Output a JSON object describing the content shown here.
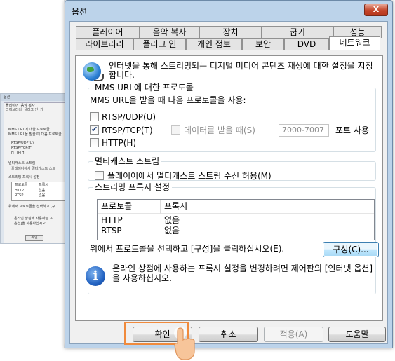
{
  "window": {
    "title": "옵션",
    "close_label": "X"
  },
  "tabs_top": [
    {
      "label": "플레이어"
    },
    {
      "label": "음악 복사"
    },
    {
      "label": "장치"
    },
    {
      "label": "굽기"
    },
    {
      "label": "성능"
    }
  ],
  "tabs_bottom": [
    {
      "label": "라이브러리"
    },
    {
      "label": "플러그 인"
    },
    {
      "label": "개인 정보"
    },
    {
      "label": "보안"
    },
    {
      "label": "DVD"
    },
    {
      "label": "네트워크"
    }
  ],
  "intro_text": "인터넷을 통해 스트리밍되는 디지털 미디어 콘텐츠 재생에 대한 설정을 지정합니다.",
  "mms": {
    "group_title": "MMS URL에 대한 프로토콜",
    "caption": "MMS URL을 받을 때 다음 프로토콜을 사용:",
    "rtsp_udp": "RTSP/UDP(U)",
    "rtsp_tcp": "RTSP/TCP(T)",
    "http": "HTTP(H)",
    "data_ports_label": "데이터를 받을 때(S)",
    "ports_value": "7000-7007",
    "ports_suffix": "포트 사용",
    "rtsp_udp_checked": false,
    "rtsp_tcp_checked": true,
    "http_checked": false
  },
  "multicast": {
    "group_title": "멀티캐스트 스트림",
    "checkbox_label": "플레이어에서 멀티캐스트 스트림 수신 허용(M)",
    "checked": false
  },
  "proxy": {
    "group_title": "스트리밍 프록시 설정",
    "columns": [
      "프로토콜",
      "프록시"
    ],
    "rows": [
      {
        "protocol": "HTTP",
        "proxy": "없음"
      },
      {
        "protocol": "RTSP",
        "proxy": "없음"
      }
    ],
    "instruction": "위에서 프로토콜을 선택하고 [구성]을 클릭하십시오(E).",
    "configure_button": "구성(C)..."
  },
  "online_store_note": "온라인 상점에 사용하는 프록시 설정을 변경하려면 제어판의 [인터넷 옵션]을 사용하십시오.",
  "buttons": {
    "ok": "확인",
    "cancel": "취소",
    "apply": "적용(A)",
    "help": "도움말"
  },
  "thumbnail": {
    "title": "옵션",
    "tabs_top": [
      "플레이어",
      "음악 복사"
    ],
    "tabs_bottom": [
      "라이브러리",
      "플러그 인",
      "개"
    ],
    "mms_caption": "MMS URL에 대한 프로토콜",
    "mms_sub": "MMS URL을 받을 때 다음 프로토콜",
    "rtsp_udp": "RTSP/UDP(U)",
    "rtsp_tcp": "RTSP/TCP(T)",
    "http": "HTTP(H)",
    "multicast": "멀티캐스트 스트림",
    "multicast_cb": "플레이어에서 멀티캐스트 스트",
    "proxy": "스트리밍 프록시 설정",
    "col_protocol": "프로토콜",
    "col_proxy": "프록시",
    "row1_protocol": "HTTP",
    "row1_proxy": "없음",
    "row2_protocol": "RTSP",
    "row2_proxy": "없음",
    "instruction": "위에서 프로토콜을 선택하고 [구",
    "note": "온라인 상점에 사용하는 프",
    "note2": "옵션]을 사용하십시오.",
    "ok": "확인"
  },
  "colors": {
    "highlight": "#f08a3c",
    "title_bar": "#bcd3ea",
    "focus_button": "#bee6fd"
  }
}
